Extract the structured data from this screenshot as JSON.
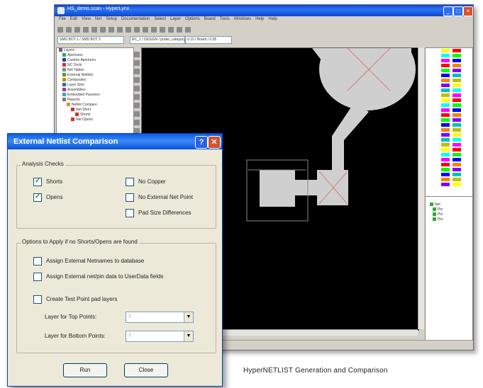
{
  "main_window": {
    "title": "HS_demo.scan - HyperLynx",
    "menu": [
      "File",
      "Edit",
      "View",
      "Net",
      "Setup",
      "Documentation",
      "Select",
      "Layer",
      "Options",
      "Board",
      "Tools",
      "Windows",
      "Help",
      "Help"
    ],
    "combo1": "SMD BOT 1 / SMD BOT 2",
    "combo2": "RC_1 / DESIGN / probe_category",
    "combo3": "0.10 / Board / 0.05",
    "colors": [
      "#ffff00",
      "#00ffff",
      "#ff00ff",
      "#ff0000",
      "#00ff00",
      "#0000ff",
      "#ff8000",
      "#8000ff",
      "#00c0c0",
      "#c0c000"
    ]
  },
  "dialog": {
    "title": "External Netlist Comparison",
    "analysis_group": "Analysis Checks",
    "shorts": "Shorts",
    "opens": "Opens",
    "no_copper": "No Copper",
    "no_external_net_point": "No External Net Point",
    "pad_size_differences": "Pad Size Differences",
    "options_group": "Options to Apply if no Shorts/Opens are found",
    "assign_netnames": "Assign External Netnames to database",
    "assign_userdata": "Assign External net/pin data to UserData fields",
    "create_test_point": "Create Test Point pad layers",
    "layer_top": "Layer for Top Points:",
    "layer_bottom": "Layer for Bottom Points:",
    "layer_top_value": "1",
    "layer_bottom_value": "1",
    "run": "Run",
    "close": "Close",
    "checks": {
      "shorts": true,
      "opens": true,
      "no_copper": false,
      "no_external_net_point": false,
      "pad_size_differences": false
    }
  },
  "caption": "HyperNETLIST Generation and Comparison"
}
